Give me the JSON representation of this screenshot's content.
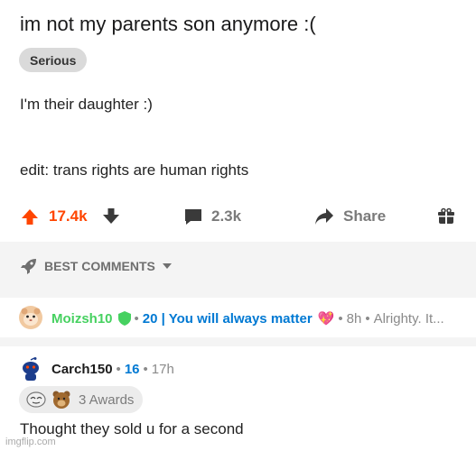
{
  "post": {
    "title": "im not my parents son anymore :(",
    "flair": "Serious",
    "body_line1": "I'm their daughter  :)",
    "body_line2": "edit: trans rights are human rights"
  },
  "actions": {
    "upvotes": "17.4k",
    "comments": "2.3k",
    "share": "Share"
  },
  "sort": {
    "label": "BEST COMMENTS"
  },
  "comments": [
    {
      "username": "Moizsh10",
      "flair": "20 | You will always matter",
      "heart": "💖",
      "age": "8h",
      "preview": "Alrighty. It..."
    },
    {
      "username": "Carch150",
      "score": "16",
      "age": "17h",
      "awards": "3 Awards",
      "text": "Thought they sold u for a second"
    }
  ],
  "watermark": "imgflip.com",
  "colors": {
    "upvote": "#ff4500",
    "username_green": "#46d160",
    "flair_blue": "#0079d3",
    "band": "#f4f4f4"
  },
  "icons": [
    "upvote-arrow-icon",
    "downvote-arrow-icon",
    "comment-bubble-icon",
    "share-arrow-icon",
    "gift-icon",
    "rocket-icon",
    "chevron-down-icon",
    "shield-icon",
    "snoo-avatar-icon"
  ]
}
